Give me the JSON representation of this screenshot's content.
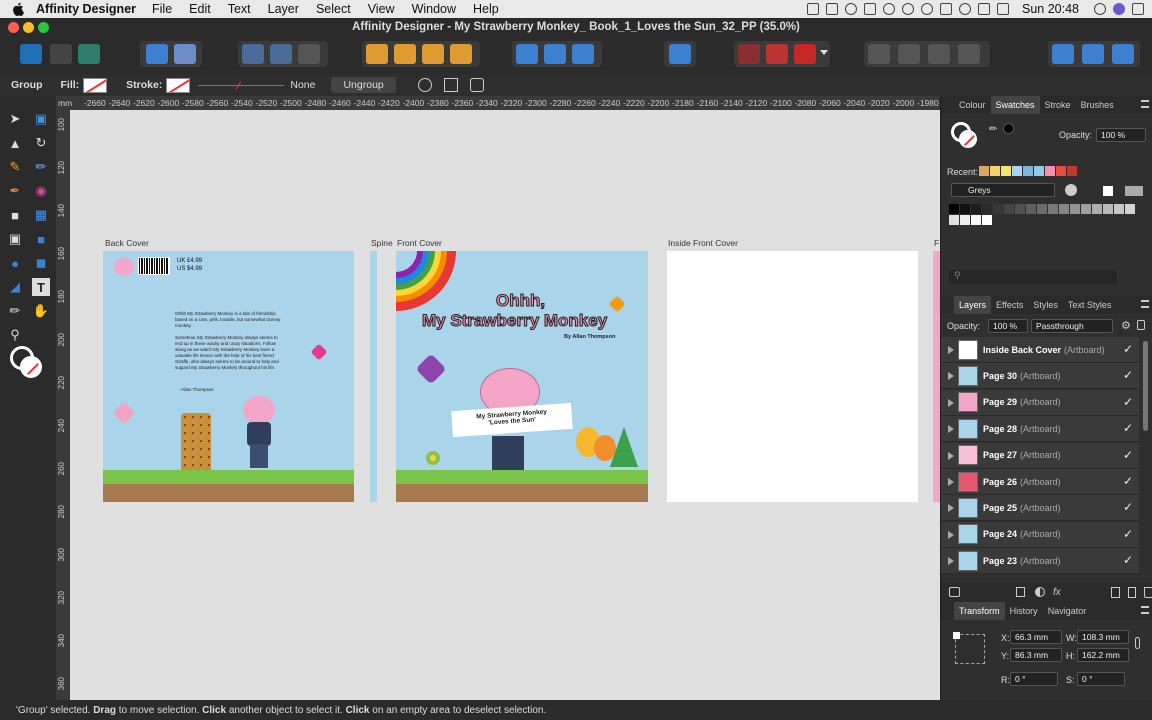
{
  "menubar": {
    "app_name": "Affinity Designer",
    "items": [
      "File",
      "Edit",
      "Text",
      "Layer",
      "Select",
      "View",
      "Window",
      "Help"
    ],
    "clock": "Sun 20:48"
  },
  "window": {
    "title": "Affinity Designer - My Strawberry Monkey_ Book_1_Loves the Sun_32_PP (35.0%)"
  },
  "context_bar": {
    "selection_type": "Group",
    "fill_label": "Fill:",
    "stroke_label": "Stroke:",
    "stroke_width": "None",
    "ungroup_label": "Ungroup"
  },
  "ruler": {
    "unit": "mm",
    "top_ticks": [
      "-2660",
      "-2640",
      "-2620",
      "-2600",
      "-2580",
      "-2560",
      "-2540",
      "-2520",
      "-2500",
      "-2480",
      "-2460",
      "-2440",
      "-2420",
      "-2400",
      "-2380",
      "-2360",
      "-2340",
      "-2320",
      "-2300",
      "-2280",
      "-2260",
      "-2240",
      "-2220",
      "-2200",
      "-2180",
      "-2160",
      "-2140",
      "-2120",
      "-2100",
      "-2080",
      "-2060",
      "-2040",
      "-2020",
      "-2000",
      "-1980"
    ],
    "left_ticks": [
      "100",
      "120",
      "140",
      "160",
      "180",
      "200",
      "220",
      "240",
      "260",
      "280",
      "300",
      "320",
      "340",
      "360"
    ]
  },
  "artboards": {
    "back_cover": {
      "label": "Back Cover",
      "price_uk": "UK £4.99",
      "price_us": "US $4.99",
      "blurb_1": "Ohhh My Strawberry Monkey is a tale of friendship based on a cute, pink, lovable, but somewhat clumsy monkey.",
      "blurb_2": "Somehow, My Strawberry Monkey always seems to end up in these wacky and crazy situations. Follow along as we watch My Strawberry Monkey learn a valuable life lesson with the help of his best friend Giraffe, who always seems to be around to help and support My Strawberry Monkey throughout his life.",
      "author_sig": "- Allan Thompson"
    },
    "spine": {
      "label": "Spine"
    },
    "front_cover": {
      "label": "Front Cover",
      "title_line1": "Ohhh,",
      "title_line2": "My Strawberry Monkey",
      "author": "By Allan Thompson",
      "sign_line1": "My Strawberry Monkey",
      "sign_line2": "'Loves the Sun'"
    },
    "inside_front_cover": {
      "label": "Inside Front Cover"
    }
  },
  "panel": {
    "top_tabs": [
      "Colour",
      "Swatches",
      "Stroke",
      "Brushes"
    ],
    "active_top_tab": "Swatches",
    "opacity_label": "Opacity:",
    "opacity_value": "100 %",
    "recent_label": "Recent:",
    "recent_colors": [
      "#d9a760",
      "#f2d36b",
      "#f5e36d",
      "#a8d6f0",
      "#7fb6e0",
      "#95c9e8",
      "#f48fb1",
      "#e84c3d",
      "#c0392b"
    ],
    "palette_name": "Greys",
    "greys": [
      "#000000",
      "#111111",
      "#1e1e1e",
      "#2b2b2b",
      "#383838",
      "#454545",
      "#525252",
      "#5f5f5f",
      "#6c6c6c",
      "#797979",
      "#868686",
      "#939393",
      "#a0a0a0",
      "#adadad",
      "#bababa",
      "#c7c7c7",
      "#d4d4d4",
      "#e1e1e1",
      "#eeeeee",
      "#f7f7f7",
      "#ffffff"
    ],
    "layers_tabs": [
      "Layers",
      "Effects",
      "Styles",
      "Text Styles"
    ],
    "active_layers_tab": "Layers",
    "layers_opacity_label": "Opacity:",
    "layers_opacity": "100 %",
    "blend_mode": "Passthrough",
    "layers": [
      {
        "name": "Inside Back Cover",
        "kind": "(Artboard)",
        "thumb": "#ffffff"
      },
      {
        "name": "Page 30",
        "kind": "(Artboard)",
        "thumb": "#a9d4ea"
      },
      {
        "name": "Page 29",
        "kind": "(Artboard)",
        "thumb": "#f4a6c8"
      },
      {
        "name": "Page 28",
        "kind": "(Artboard)",
        "thumb": "#a9d4ea"
      },
      {
        "name": "Page 27",
        "kind": "(Artboard)",
        "thumb": "#f7c0d4"
      },
      {
        "name": "Page 26",
        "kind": "(Artboard)",
        "thumb": "#e8576f"
      },
      {
        "name": "Page 25",
        "kind": "(Artboard)",
        "thumb": "#a9d4ea"
      },
      {
        "name": "Page  24",
        "kind": "(Artboard)",
        "thumb": "#a9d4ea"
      },
      {
        "name": "Page  23",
        "kind": "(Artboard)",
        "thumb": "#a9d4ea"
      }
    ],
    "transform_tabs": [
      "Transform",
      "History",
      "Navigator"
    ],
    "active_transform_tab": "Transform",
    "transform": {
      "x_label": "X:",
      "x": "66.3 mm",
      "y_label": "Y:",
      "y": "86.3 mm",
      "w_label": "W:",
      "w": "108.3 mm",
      "h_label": "H:",
      "h": "162.2 mm",
      "r_label": "R:",
      "r": "0 °",
      "s_label": "S:",
      "s": "0 °"
    }
  },
  "status": {
    "segments": [
      {
        "text": "'Group' selected. ",
        "bold": false
      },
      {
        "text": "Drag",
        "bold": true
      },
      {
        "text": " to move selection. ",
        "bold": false
      },
      {
        "text": "Click",
        "bold": true
      },
      {
        "text": " another object to select it. ",
        "bold": false
      },
      {
        "text": "Click",
        "bold": true
      },
      {
        "text": " on an empty area to deselect selection.",
        "bold": false
      }
    ]
  }
}
